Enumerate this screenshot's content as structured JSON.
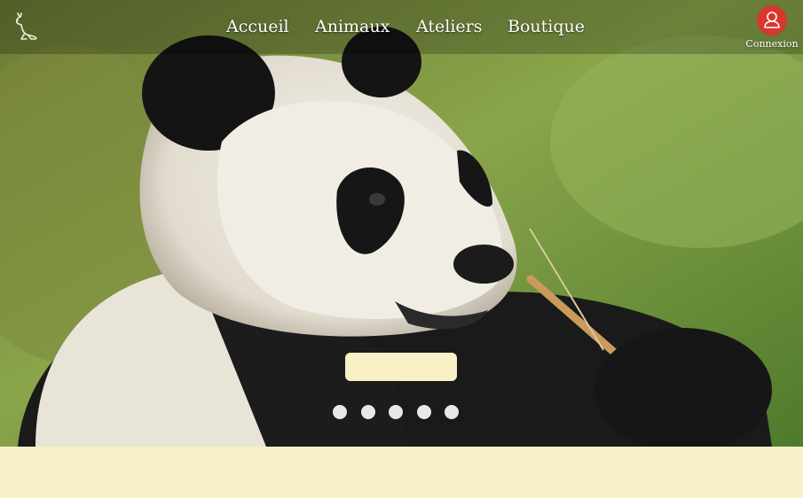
{
  "nav": {
    "items": [
      {
        "label": "Accueil"
      },
      {
        "label": "Animaux"
      },
      {
        "label": "Ateliers"
      },
      {
        "label": "Boutique"
      }
    ]
  },
  "login": {
    "label": "Connexion",
    "icon": "user-icon"
  },
  "logo": {
    "icon": "kangaroo-logo-icon"
  },
  "hero": {
    "image": "giant-panda-eating-bamboo",
    "slide_count": 5
  },
  "colors": {
    "accent": "#d7382e",
    "cream": "#f9f0c8",
    "dot": "#e8e8e8"
  }
}
